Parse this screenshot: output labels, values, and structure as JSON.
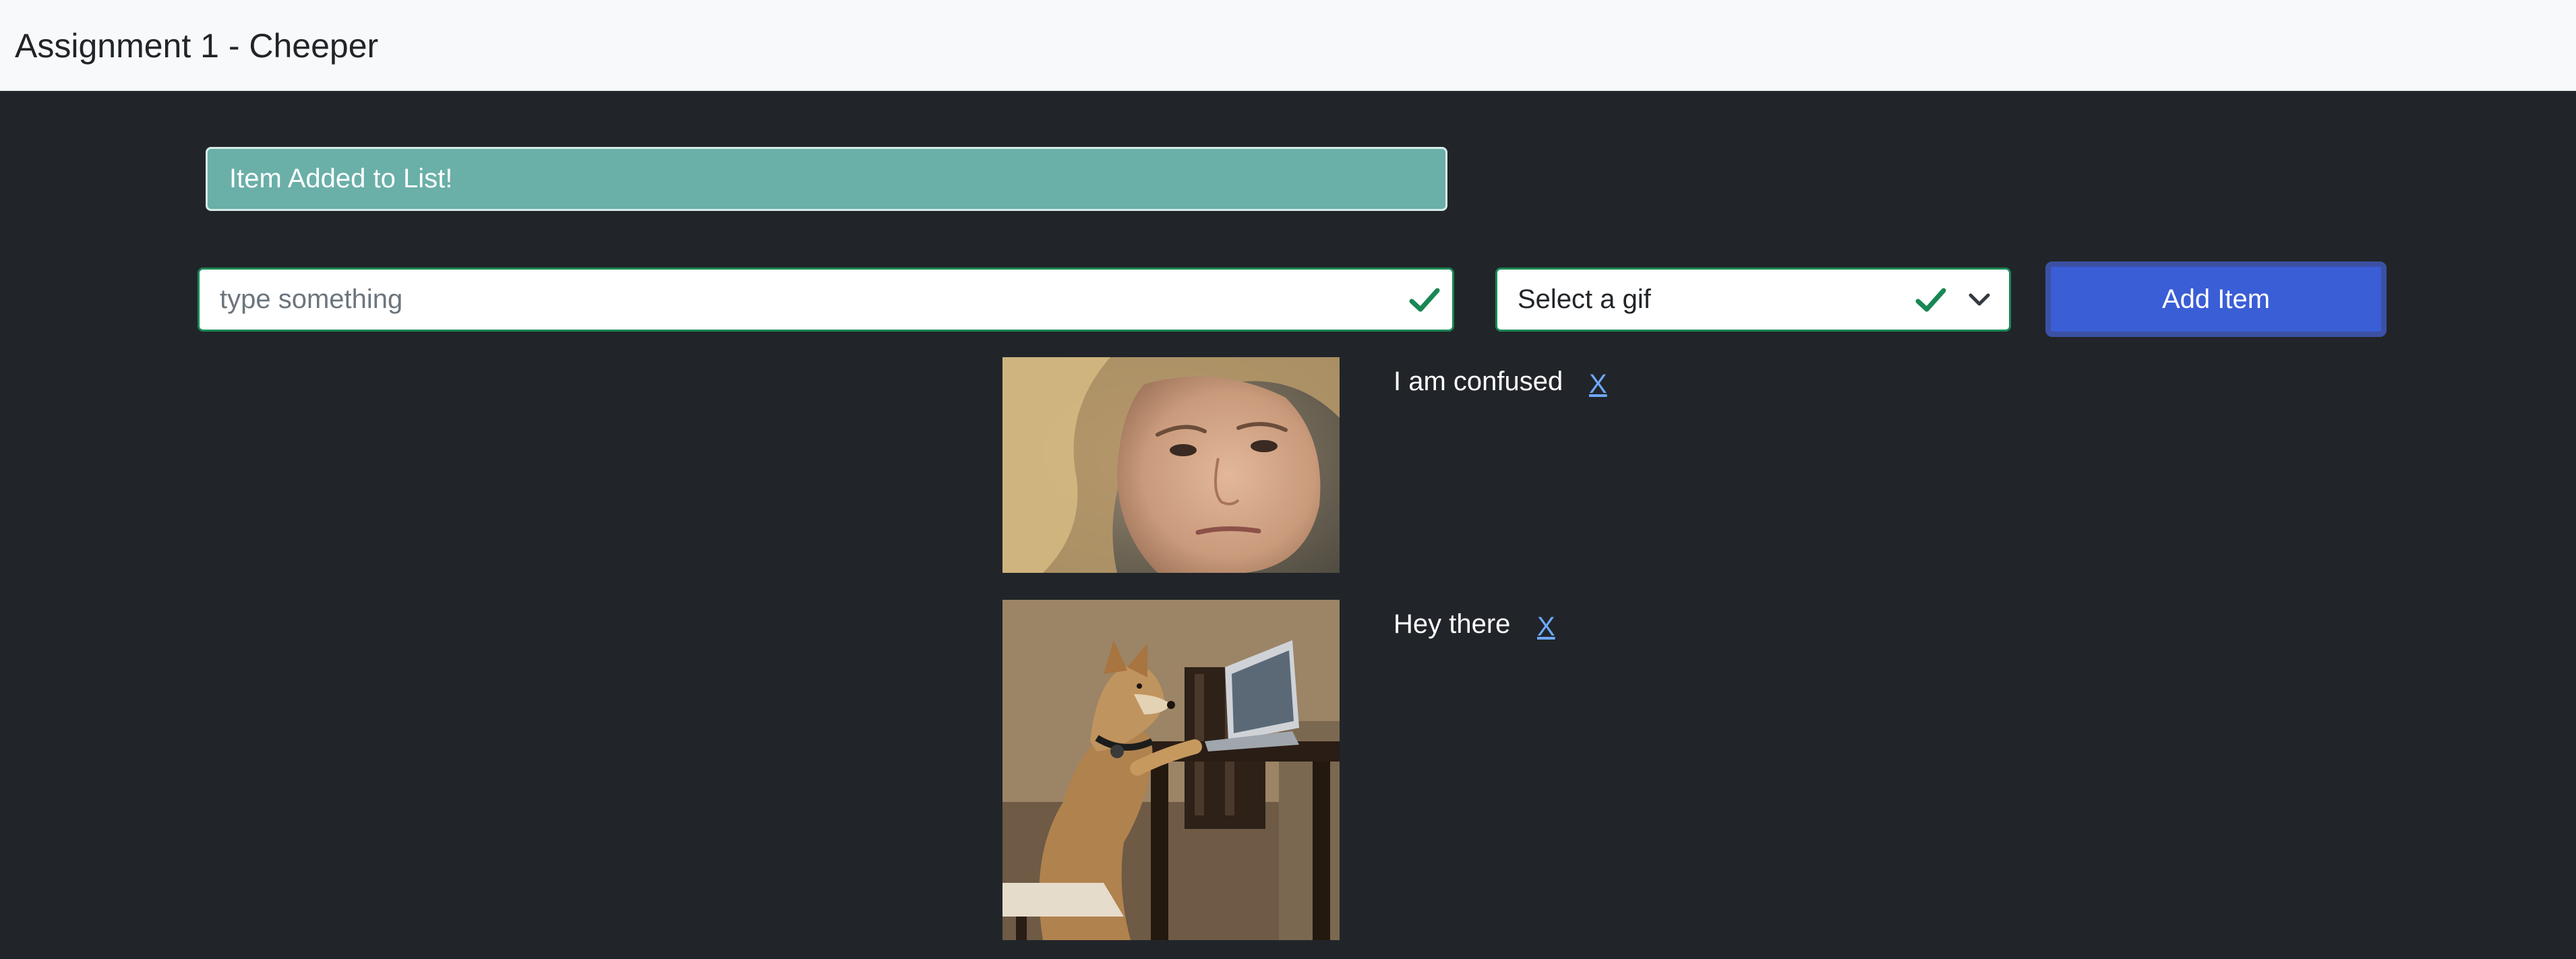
{
  "navbar": {
    "title": "Assignment 1 - Cheeper"
  },
  "alert": {
    "message": "Item Added to List!"
  },
  "form": {
    "text_input": {
      "value": "",
      "placeholder": "type something",
      "valid_icon": "check-icon"
    },
    "gif_select": {
      "selected": "Select a gif",
      "valid_icon": "check-icon",
      "arrow_icon": "chevron-down-icon"
    },
    "add_button": {
      "label": "Add Item",
      "color": "#3a5ed6"
    }
  },
  "items": [
    {
      "text": "I am confused",
      "delete_label": "X",
      "gif_subject": "confused woman"
    },
    {
      "text": "Hey there",
      "delete_label": "X",
      "gif_subject": "dog typing on laptop"
    }
  ],
  "colors": {
    "background": "#212529",
    "navbar": "#f8f9fa",
    "alert": "#6aafa8",
    "valid": "#198754",
    "link": "#6ea8fe"
  }
}
